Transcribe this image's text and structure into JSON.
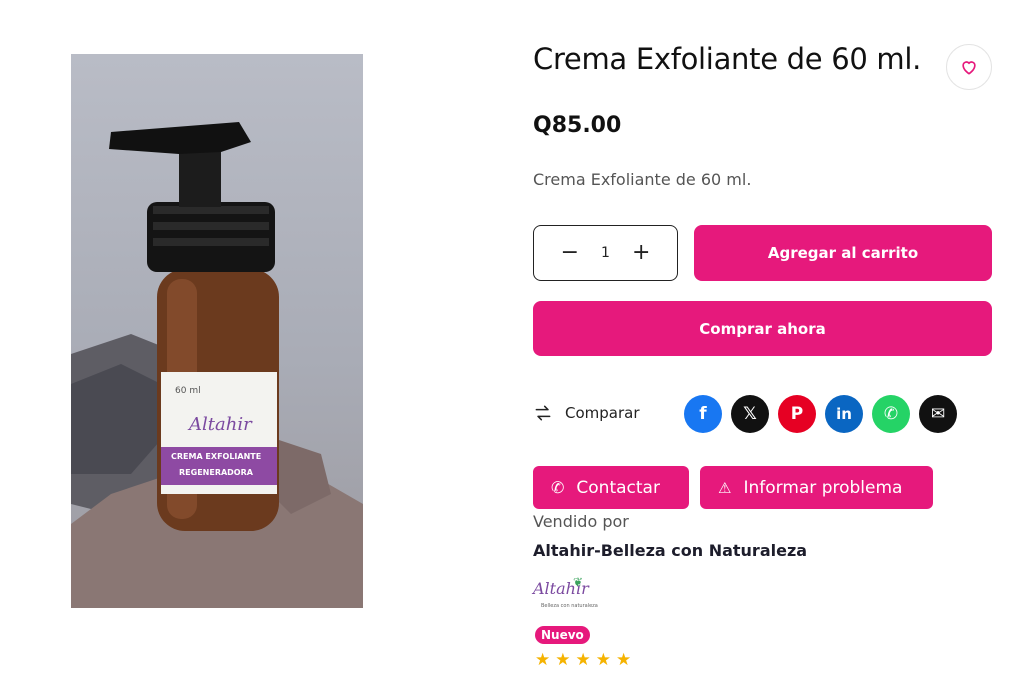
{
  "product": {
    "title": "Crema Exfoliante de 60 ml.",
    "price": "Q85.00",
    "short_description": "Crema Exfoliante de 60 ml.",
    "image": {
      "label_size": "60 ml",
      "brand": "Altahir",
      "label_line1": "CREMA EXFOLIANTE",
      "label_line2": "REGENERADORA"
    }
  },
  "purchase": {
    "quantity": "1",
    "minus": "−",
    "plus": "+",
    "add_to_cart": "Agregar al carrito",
    "buy_now": "Comprar ahora"
  },
  "actions": {
    "compare": "Comparar",
    "contact": "Contactar",
    "report": "Informar problema"
  },
  "share": [
    {
      "icon": "facebook-icon",
      "glyph": "f",
      "color": "#1877f2"
    },
    {
      "icon": "x-icon",
      "glyph": "𝕏",
      "color": "#111111"
    },
    {
      "icon": "pinterest-icon",
      "glyph": "P",
      "color": "#e60023"
    },
    {
      "icon": "linkedin-icon",
      "glyph": "in",
      "color": "#0a66c2"
    },
    {
      "icon": "whatsapp-icon",
      "glyph": "✆",
      "color": "#25d366"
    },
    {
      "icon": "email-icon",
      "glyph": "✉",
      "color": "#111111"
    }
  ],
  "vendor": {
    "sold_by_label": "Vendido por",
    "name": "Altahir-Belleza con Naturaleza",
    "logo_text": "Altahir",
    "logo_subtext": "Belleza con naturaleza",
    "badge": "Nuevo",
    "rating": 5
  },
  "colors": {
    "accent": "#e6197c",
    "star": "#f5b301"
  }
}
